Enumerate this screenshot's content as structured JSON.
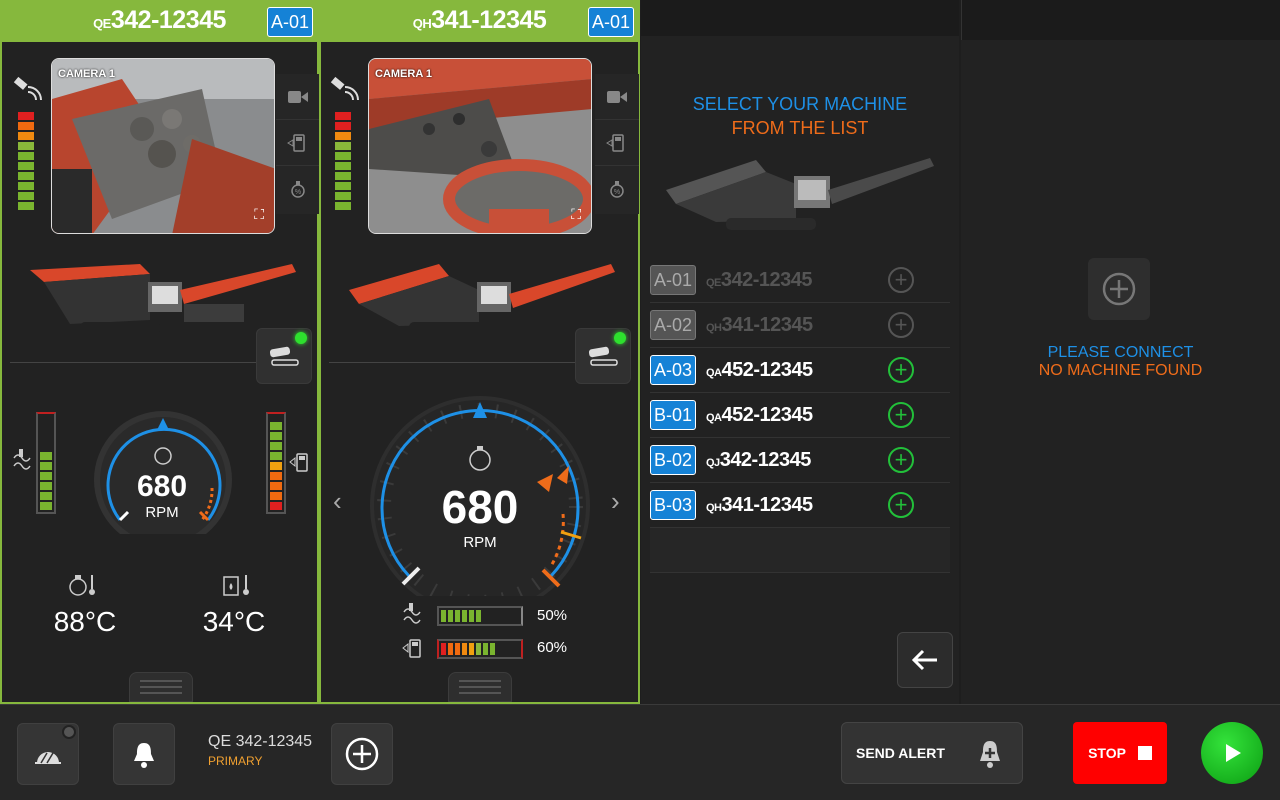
{
  "panel1": {
    "title_prefix": "QE",
    "title_main": "342-12345",
    "slot": "A-01",
    "camera_label": "CAMERA 1",
    "rpm_value": "680",
    "rpm_unit": "RPM",
    "temp_engine": "88°C",
    "temp_hydraulic": "34°C",
    "signal_level": 0.75,
    "coolant_level": 0.55,
    "fuel_level": 0.8
  },
  "panel2": {
    "title_prefix": "QH",
    "title_main": "341-12345",
    "slot": "A-01",
    "camera_label": "CAMERA 1",
    "rpm_value": "680",
    "rpm_unit": "RPM",
    "coolant_pct": "50%",
    "fuel_pct": "60%",
    "coolant_level": 0.5,
    "fuel_level": 0.6,
    "signal_level": 0.75
  },
  "list_panel": {
    "select_line1": "SELECT YOUR MACHINE",
    "select_line2": "FROM THE LIST",
    "machines": [
      {
        "slot": "A-01",
        "prefix": "QE",
        "name": "342-12345",
        "active": false
      },
      {
        "slot": "A-02",
        "prefix": "QH",
        "name": "341-12345",
        "active": false
      },
      {
        "slot": "A-03",
        "prefix": "QA",
        "name": "452-12345",
        "active": true
      },
      {
        "slot": "B-01",
        "prefix": "QA",
        "name": "452-12345",
        "active": true
      },
      {
        "slot": "B-02",
        "prefix": "QJ",
        "name": "342-12345",
        "active": true
      },
      {
        "slot": "B-03",
        "prefix": "QH",
        "name": "341-12345",
        "active": true
      }
    ]
  },
  "empty_panel": {
    "line1": "PLEASE CONNECT",
    "line2": "NO MACHINE FOUND"
  },
  "bottom_bar": {
    "machine_name": "QE 342-12345",
    "machine_role": "PRIMARY",
    "send_alert": "SEND ALERT",
    "stop": "STOP"
  },
  "colors": {
    "panel_green": "#86b83d",
    "slot_blue": "#1582d6",
    "accent_blue": "#1e90e6",
    "accent_orange": "#ef6c1a",
    "plus_green": "#22c03a",
    "stop_red": "#ff0000"
  }
}
